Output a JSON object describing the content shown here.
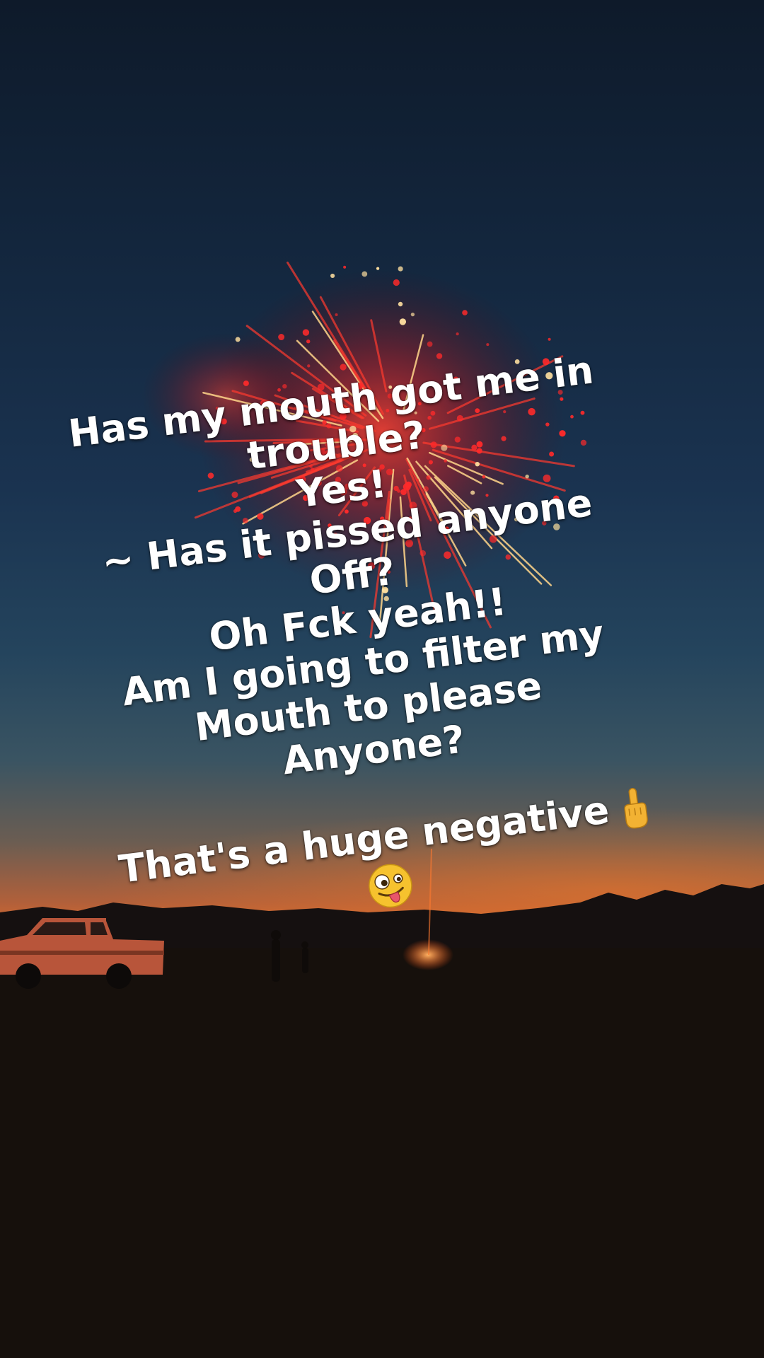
{
  "caption": {
    "lines": [
      "Has my mouth got me in",
      "trouble?",
      "Yes!",
      "~ Has it pissed anyone",
      "Off?",
      "Oh Fck yeah!!",
      "Am I going to filter my",
      "Mouth to please",
      "Anyone?"
    ],
    "final_line": "That's a huge negative"
  },
  "icons": {
    "finger": "middle-finger-emoji",
    "face": "zany-face-emoji"
  },
  "colors": {
    "caption_text": "#ffffff",
    "firework_red": "#ff2a2a",
    "firework_gold": "#ffd58a",
    "sunset_orange": "#d86a2c"
  }
}
